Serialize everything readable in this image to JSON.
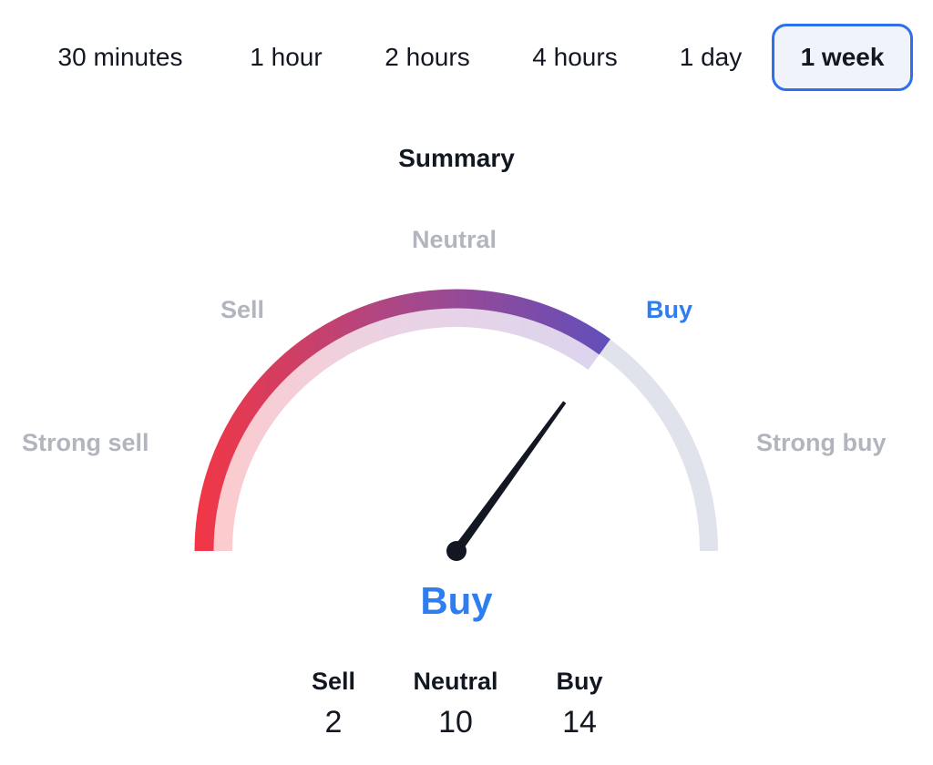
{
  "tabs": [
    {
      "label": "30 minutes",
      "active": false
    },
    {
      "label": "1 hour",
      "active": false
    },
    {
      "label": "2 hours",
      "active": false
    },
    {
      "label": "4 hours",
      "active": false
    },
    {
      "label": "1 day",
      "active": false
    },
    {
      "label": "1 week",
      "active": true
    }
  ],
  "summary": {
    "title": "Summary",
    "scale_labels": {
      "strong_sell": "Strong sell",
      "sell": "Sell",
      "neutral": "Neutral",
      "buy": "Buy",
      "strong_buy": "Strong buy"
    },
    "gauge_value": 0.7,
    "result": "Buy",
    "colors": {
      "start": "#f23645",
      "mid": "#a7488a",
      "end": "#5f4fbd",
      "track": "#e0e3eb",
      "accent": "#2f7ef0",
      "needle": "#131722"
    },
    "counts": [
      {
        "label": "Sell",
        "value": "2"
      },
      {
        "label": "Neutral",
        "value": "10"
      },
      {
        "label": "Buy",
        "value": "14"
      }
    ]
  }
}
